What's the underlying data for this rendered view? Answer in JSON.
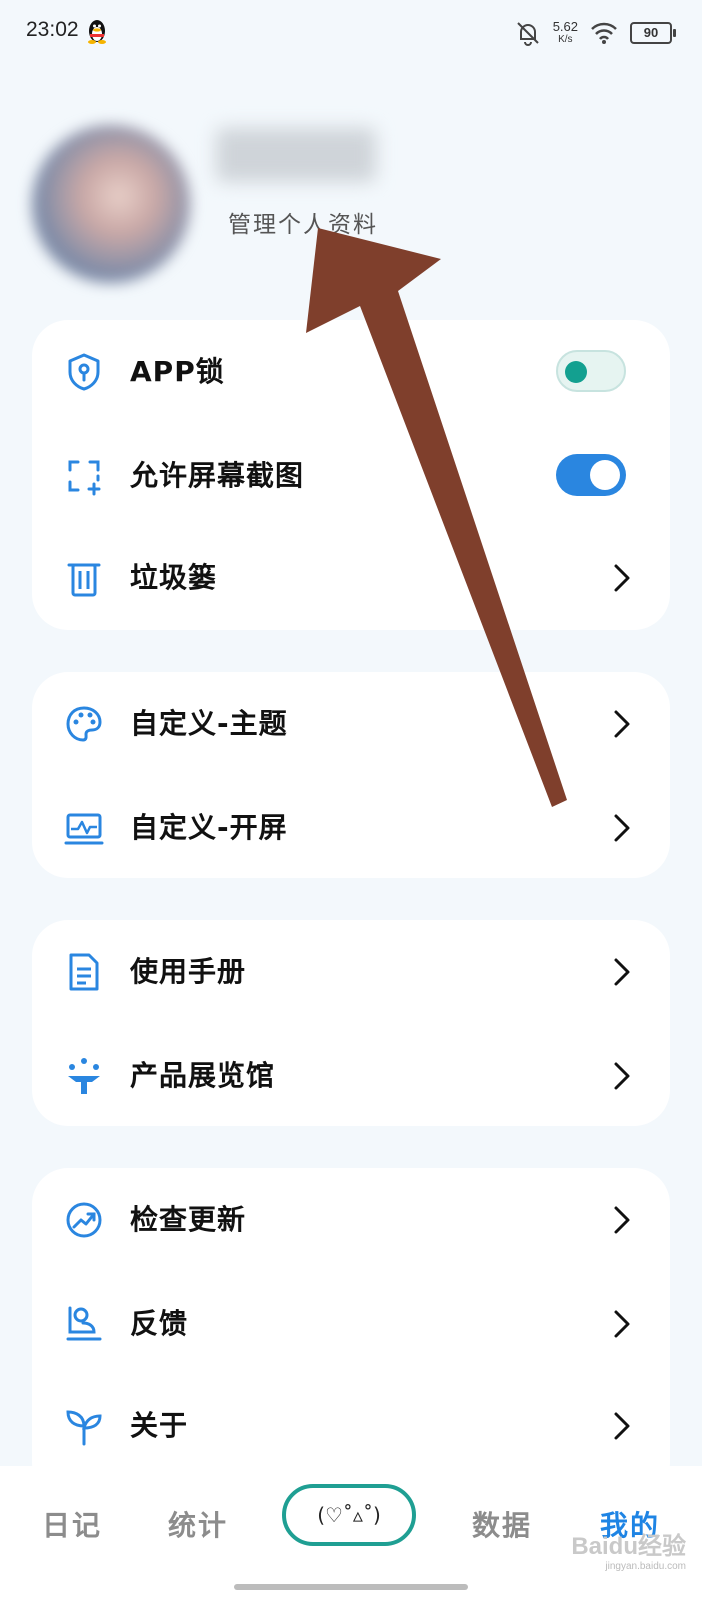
{
  "status_bar": {
    "time": "23:02",
    "net_speed": "5.62",
    "net_speed_unit": "K/s",
    "battery": "90"
  },
  "profile": {
    "nickname": "昵称",
    "manage_label": "管理个人资料"
  },
  "settings": {
    "app_lock": {
      "label": "APP锁",
      "enabled": false
    },
    "screenshot": {
      "label": "允许屏幕截图",
      "enabled": true
    },
    "trash": {
      "label": "垃圾篓"
    },
    "theme": {
      "label": "自定义-主题"
    },
    "splash": {
      "label": "自定义-开屏"
    },
    "manual": {
      "label": "使用手册"
    },
    "gallery": {
      "label": "产品展览馆"
    },
    "update": {
      "label": "检查更新"
    },
    "feedback": {
      "label": "反馈"
    },
    "about": {
      "label": "关于"
    }
  },
  "tabbar": {
    "diary": "日记",
    "stats": "统计",
    "center": "(♡˚▵˚)",
    "data": "数据",
    "mine": "我的"
  },
  "watermark": {
    "brand": "Baidu经验",
    "url": "jingyan.baidu.com"
  },
  "colors": {
    "accent": "#1e84e4",
    "icon": "#2a86e0",
    "toggle_on": "#2a86e0",
    "arrow": "#7f3f2c",
    "background": "#f3f8fc"
  }
}
